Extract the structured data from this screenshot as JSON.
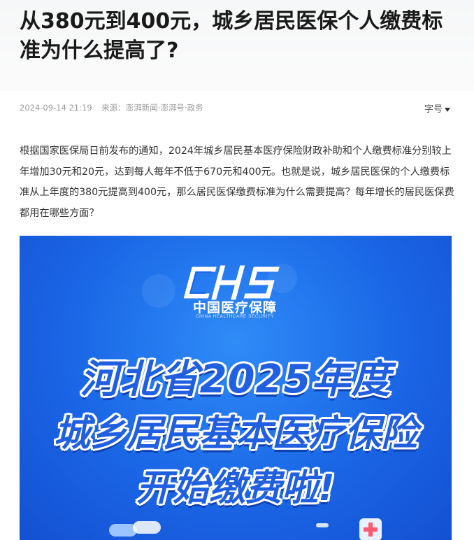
{
  "article": {
    "title": "从380元到400元，城乡居民医保个人缴费标准为什么提高了?",
    "date": "2024-09-14 21:19",
    "source": "来源：澎湃新闻·澎湃号·政务",
    "font_size_label": "字号",
    "paragraph": "根据国家医保局日前发布的通知，2024年城乡居民基本医疗保险财政补助和个人缴费标准分别较上年增加30元和20元，达到每人每年不低于670元和400元。也就是说，城乡居民医保的个人缴费标准从上年度的380元提高到400元，那么居民医保缴费标准为什么需要提高？每年增长的居民医保费都用在哪些方面？"
  },
  "poster": {
    "logo_mark": "CHS",
    "logo_cn": "中国医疗保障",
    "logo_en": "CHINA HEALTHCARE SECURITY",
    "line1": "河北省2025年度",
    "line2": "城乡居民基本医疗保险",
    "line3": "开始缴费啦!"
  },
  "colors": {
    "poster_bg": "#1a66e6",
    "headline_fill": "#1f5fe0",
    "headline_outline": "#ffffff"
  }
}
